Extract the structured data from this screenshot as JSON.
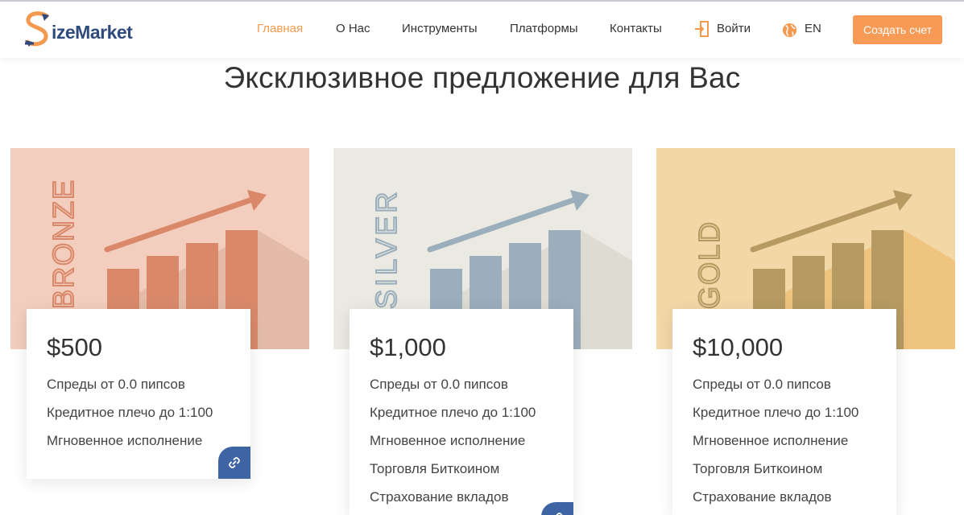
{
  "brand": {
    "logo_text": "izeMarket",
    "logo_letter": "S"
  },
  "nav": {
    "items": [
      "Главная",
      "О Нас",
      "Инструменты",
      "Платформы",
      "Контакты"
    ],
    "active": "Главная",
    "login": "Войти",
    "language": "EN",
    "cta": "Создать счет"
  },
  "title": "Эксклюзивное предложение для Вас",
  "plans": [
    {
      "tier": "BRONZE",
      "price": "$500",
      "features": [
        "Спреды от 0.0 пипсов",
        "Кредитное плечо до 1:100",
        "Мгновенное исполнение"
      ]
    },
    {
      "tier": "SILVER",
      "price": "$1,000",
      "features": [
        "Спреды от 0.0 пипсов",
        "Кредитное плечо до 1:100",
        "Мгновенное исполнение",
        "Торговля Биткоином",
        "Страхование вкладов"
      ]
    },
    {
      "tier": "GOLD",
      "price": "$10,000",
      "features": [
        "Спреды от 0.0 пипсов",
        "Кредитное плечо до 1:100",
        "Мгновенное исполнение",
        "Торговля Биткоином",
        "Страхование вкладов"
      ]
    }
  ],
  "colors": {
    "accent": "#f79a56",
    "nav_active": "#f39a4f",
    "link_button": "#3f64a3",
    "logo_blue": "#2f4a7d",
    "bronze_bg": "#f3cdbd",
    "bronze_fg": "#d9896a",
    "silver_bg": "#eae9e2",
    "silver_fg": "#9aaebb",
    "gold_bg": "#f2d7a7",
    "gold_fg": "#b69a62"
  },
  "icons": [
    "login-door-icon",
    "globe-icon",
    "link-icon",
    "trend-arrow-icon"
  ]
}
